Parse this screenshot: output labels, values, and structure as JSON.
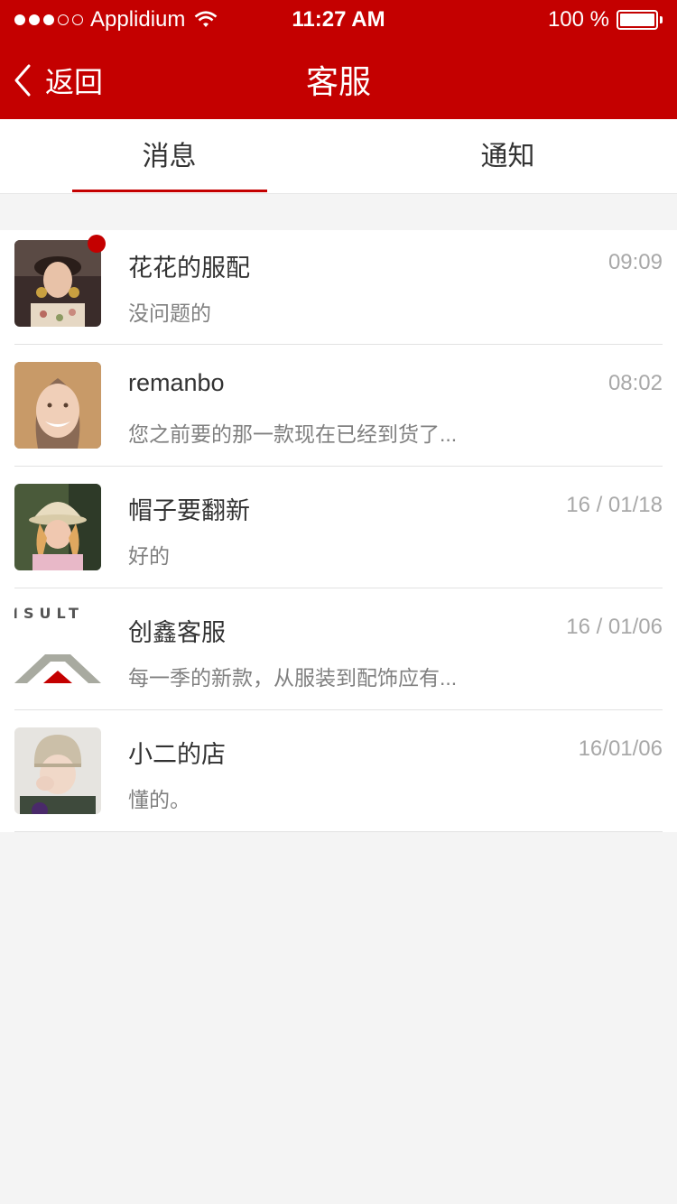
{
  "status": {
    "carrier": "Applidium",
    "time": "11:27 AM",
    "battery": "100 %"
  },
  "nav": {
    "back_label": "返回",
    "title": "客服"
  },
  "tabs": {
    "messages": "消息",
    "notifications": "通知"
  },
  "conversations": [
    {
      "name": "花花的服配",
      "message": "没问题的",
      "date": "09:09",
      "unread": true
    },
    {
      "name": "remanbo",
      "message": "您之前要的那一款现在已经到货了...",
      "date": "08:02",
      "unread": false
    },
    {
      "name": "帽子要翻新",
      "message": "好的",
      "date": "16 / 01/18",
      "unread": false
    },
    {
      "name": "创鑫客服",
      "message": "每一季的新款，从服装到配饰应有...",
      "date": "16 / 01/06",
      "unread": false
    },
    {
      "name": "小二的店",
      "message": "懂的。",
      "date": "16/01/06",
      "unread": false
    }
  ],
  "avatar4_logo_text": "ISULT",
  "colors": {
    "brand": "#c40000",
    "background": "#f4f4f4"
  }
}
